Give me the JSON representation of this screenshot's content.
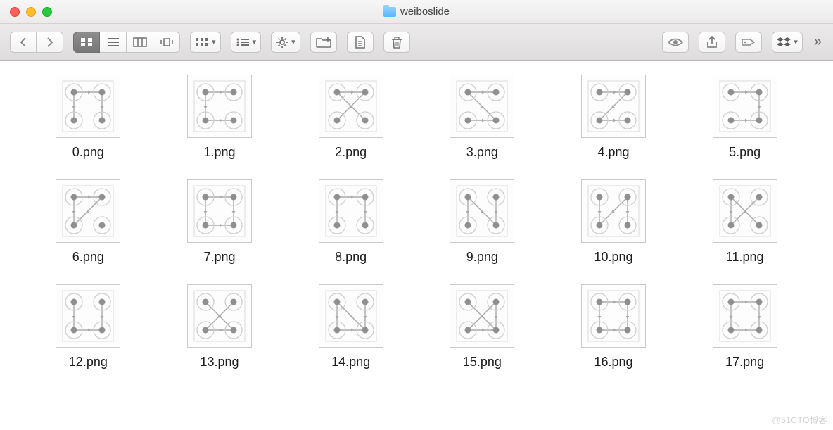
{
  "window": {
    "title": "weiboslide"
  },
  "watermark": "@51CTO博客",
  "files": [
    {
      "name": "0.png",
      "edges": [
        [
          0,
          1
        ],
        [
          0,
          2
        ],
        [
          1,
          3
        ]
      ]
    },
    {
      "name": "1.png",
      "edges": [
        [
          0,
          1
        ],
        [
          0,
          2
        ],
        [
          2,
          3
        ]
      ]
    },
    {
      "name": "2.png",
      "edges": [
        [
          0,
          1
        ],
        [
          0,
          3
        ],
        [
          1,
          2
        ]
      ]
    },
    {
      "name": "3.png",
      "edges": [
        [
          0,
          1
        ],
        [
          0,
          3
        ],
        [
          2,
          3
        ]
      ]
    },
    {
      "name": "4.png",
      "edges": [
        [
          0,
          1
        ],
        [
          1,
          2
        ],
        [
          2,
          3
        ]
      ]
    },
    {
      "name": "5.png",
      "edges": [
        [
          0,
          1
        ],
        [
          1,
          3
        ],
        [
          2,
          3
        ]
      ]
    },
    {
      "name": "6.png",
      "edges": [
        [
          0,
          1
        ],
        [
          1,
          2
        ],
        [
          0,
          2
        ]
      ]
    },
    {
      "name": "7.png",
      "edges": [
        [
          0,
          1
        ],
        [
          0,
          2
        ],
        [
          1,
          3
        ],
        [
          2,
          3
        ]
      ]
    },
    {
      "name": "8.png",
      "edges": [
        [
          0,
          2
        ],
        [
          0,
          1
        ],
        [
          1,
          3
        ]
      ]
    },
    {
      "name": "9.png",
      "edges": [
        [
          0,
          2
        ],
        [
          0,
          3
        ],
        [
          1,
          3
        ]
      ]
    },
    {
      "name": "10.png",
      "edges": [
        [
          0,
          2
        ],
        [
          1,
          2
        ],
        [
          1,
          3
        ]
      ]
    },
    {
      "name": "11.png",
      "edges": [
        [
          0,
          2
        ],
        [
          1,
          2
        ],
        [
          0,
          3
        ]
      ]
    },
    {
      "name": "12.png",
      "edges": [
        [
          0,
          2
        ],
        [
          1,
          3
        ],
        [
          2,
          3
        ]
      ]
    },
    {
      "name": "13.png",
      "edges": [
        [
          0,
          3
        ],
        [
          1,
          2
        ],
        [
          2,
          3
        ]
      ]
    },
    {
      "name": "14.png",
      "edges": [
        [
          0,
          2
        ],
        [
          0,
          3
        ],
        [
          1,
          3
        ],
        [
          2,
          3
        ]
      ]
    },
    {
      "name": "15.png",
      "edges": [
        [
          0,
          3
        ],
        [
          1,
          2
        ],
        [
          1,
          3
        ],
        [
          2,
          3
        ]
      ]
    },
    {
      "name": "16.png",
      "edges": [
        [
          0,
          2
        ],
        [
          0,
          1
        ],
        [
          1,
          3
        ],
        [
          2,
          3
        ]
      ]
    },
    {
      "name": "17.png",
      "edges": [
        [
          0,
          1
        ],
        [
          0,
          2
        ],
        [
          2,
          3
        ],
        [
          1,
          3
        ]
      ]
    }
  ]
}
